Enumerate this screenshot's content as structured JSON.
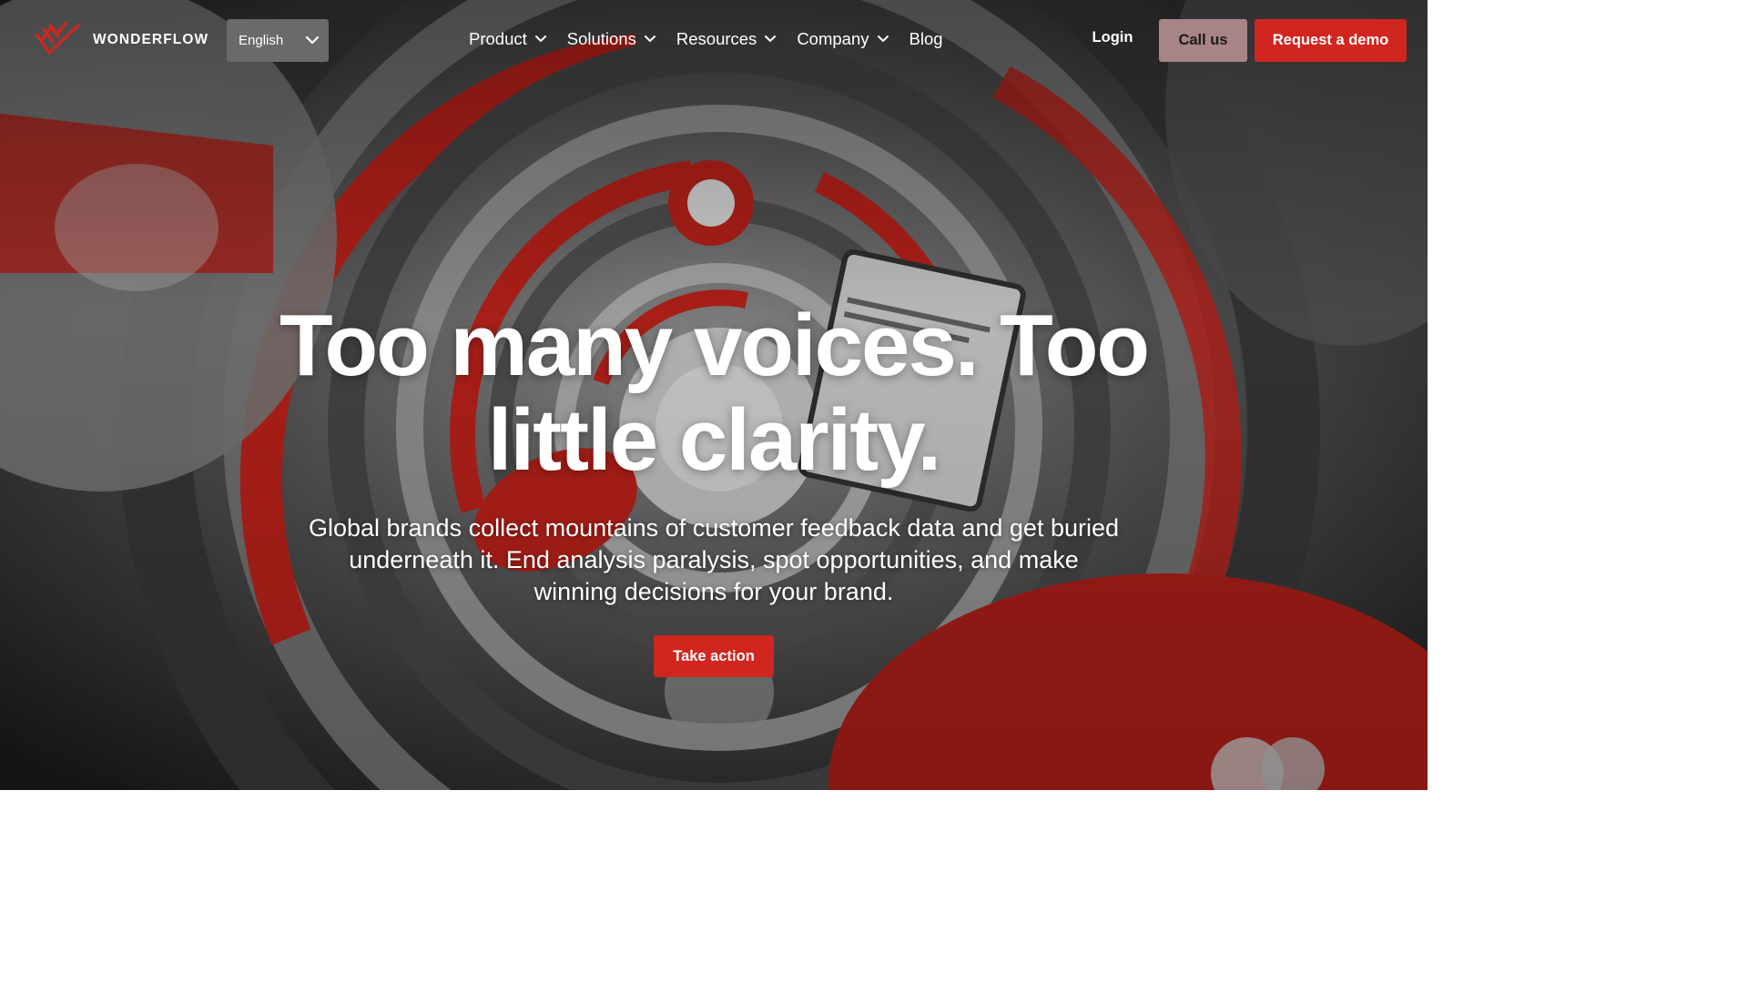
{
  "brand": {
    "name": "WONDERFLOW",
    "logo_icon": "wonderflow-logo-icon"
  },
  "language": {
    "selected": "English",
    "icon": "chevron-down-icon"
  },
  "nav": {
    "items": [
      {
        "label": "Product",
        "has_dropdown": true
      },
      {
        "label": "Solutions",
        "has_dropdown": true
      },
      {
        "label": "Resources",
        "has_dropdown": true
      },
      {
        "label": "Company",
        "has_dropdown": true
      },
      {
        "label": "Blog",
        "has_dropdown": false
      }
    ]
  },
  "actions": {
    "login": "Login",
    "call_us": "Call us",
    "request_demo": "Request a demo"
  },
  "hero": {
    "title": "Too many voices. Too little clarity.",
    "subtitle": "Global brands collect mountains of customer feedback data and get buried underneath it. End analysis paralysis, spot opportunities, and make winning decisions for your brand.",
    "cta": "Take action"
  },
  "colors": {
    "accent": "#d0261f",
    "call_us_bg": "#a78485",
    "language_bg": "#6a6a6c",
    "text_on_dark": "#ffffff"
  }
}
